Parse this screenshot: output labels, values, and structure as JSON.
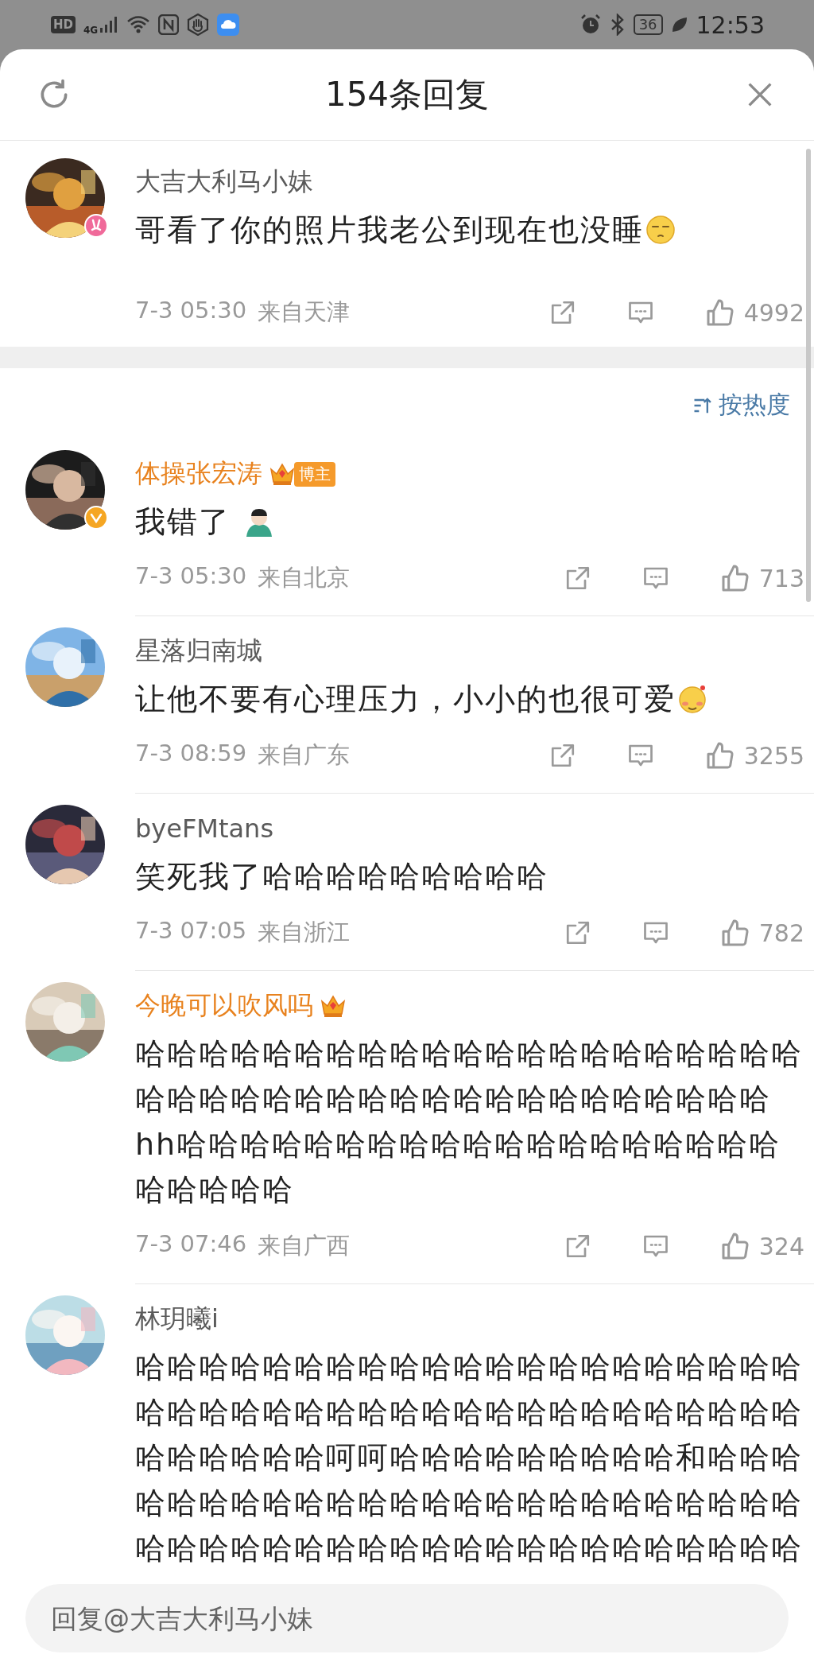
{
  "status_bar": {
    "network_badge": "HD",
    "network_type": "4G",
    "battery": "36",
    "time": "12:53"
  },
  "header": {
    "title": "154条回复"
  },
  "parent_comment": {
    "user": "大吉大利马小妹",
    "vip": false,
    "avatar_badge": {
      "kind": "bunny"
    },
    "text": "哥看了你的照片我老公到现在也没睡",
    "emoji": {
      "kind": "sleepy"
    },
    "time": "7-3 05:30",
    "location": "来自天津",
    "likes": "4992"
  },
  "sort": {
    "label": "按热度"
  },
  "replies": [
    {
      "user": "体操张宏涛",
      "vip": true,
      "avatar_badge": {
        "kind": "verified"
      },
      "badges": [
        {
          "kind": "crown"
        },
        {
          "kind": "label",
          "text": "博主"
        }
      ],
      "text": "我错了 ",
      "emoji": {
        "kind": "bowing"
      },
      "time": "7-3 05:30",
      "location": "来自北京",
      "likes": "713"
    },
    {
      "user": "星落归南城",
      "vip": false,
      "text": "让他不要有心理压力，小小的也很可爱",
      "emoji": {
        "kind": "blush"
      },
      "time": "7-3 08:59",
      "location": "来自广东",
      "likes": "3255"
    },
    {
      "user": "byeFMtans",
      "vip": false,
      "text": "笑死我了哈哈哈哈哈哈哈哈哈",
      "time": "7-3 07:05",
      "location": "来自浙江",
      "likes": "782"
    },
    {
      "user": "今晚可以吹风吗",
      "vip": true,
      "badges": [
        {
          "kind": "crown"
        }
      ],
      "text": "哈哈哈哈哈哈哈哈哈哈哈哈哈哈哈哈哈哈哈哈哈哈哈哈哈哈哈哈哈哈哈哈哈哈哈哈哈哈哈哈哈hh哈哈哈哈哈哈哈哈哈哈哈哈哈哈哈哈哈哈哈哈哈哈哈哈",
      "time": "7-3 07:46",
      "location": "来自广西",
      "likes": "324"
    },
    {
      "user": "林玥曦i",
      "vip": false,
      "text": "哈哈哈哈哈哈哈哈哈哈哈哈哈哈哈哈哈哈哈哈哈哈哈哈哈哈哈哈哈哈哈哈哈哈哈哈哈哈哈哈哈哈哈哈哈哈哈哈呵呵哈哈哈哈哈哈哈哈哈和哈哈哈哈哈哈哈哈哈哈哈哈哈哈哈哈哈哈哈哈哈哈哈哈哈哈哈哈哈哈哈哈哈哈哈哈哈哈哈哈哈哈哈哈哈"
    }
  ],
  "reply_input": {
    "placeholder": "回复@大吉大利马小妹"
  }
}
